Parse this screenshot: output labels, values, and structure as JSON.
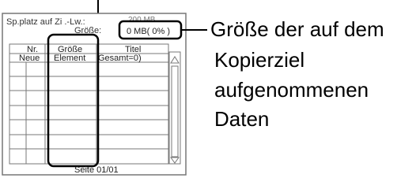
{
  "screen": {
    "space_label_1": "Sp.platz auf Zi .-Lw.:",
    "space_value_1": "200 MB",
    "size_label": "Größe:",
    "size_value": "0 MB( 0% )",
    "columns": [
      "Nr.",
      "Größe",
      "Titel"
    ],
    "first_row": [
      "Neue",
      "Element",
      "Gesamt=0)"
    ],
    "page_indicator": "Seite 01/01"
  },
  "callout": {
    "line1": "Größe der auf dem",
    "line2": "Kopierziel",
    "line3": "aufgenommenen",
    "line4": "Daten"
  }
}
